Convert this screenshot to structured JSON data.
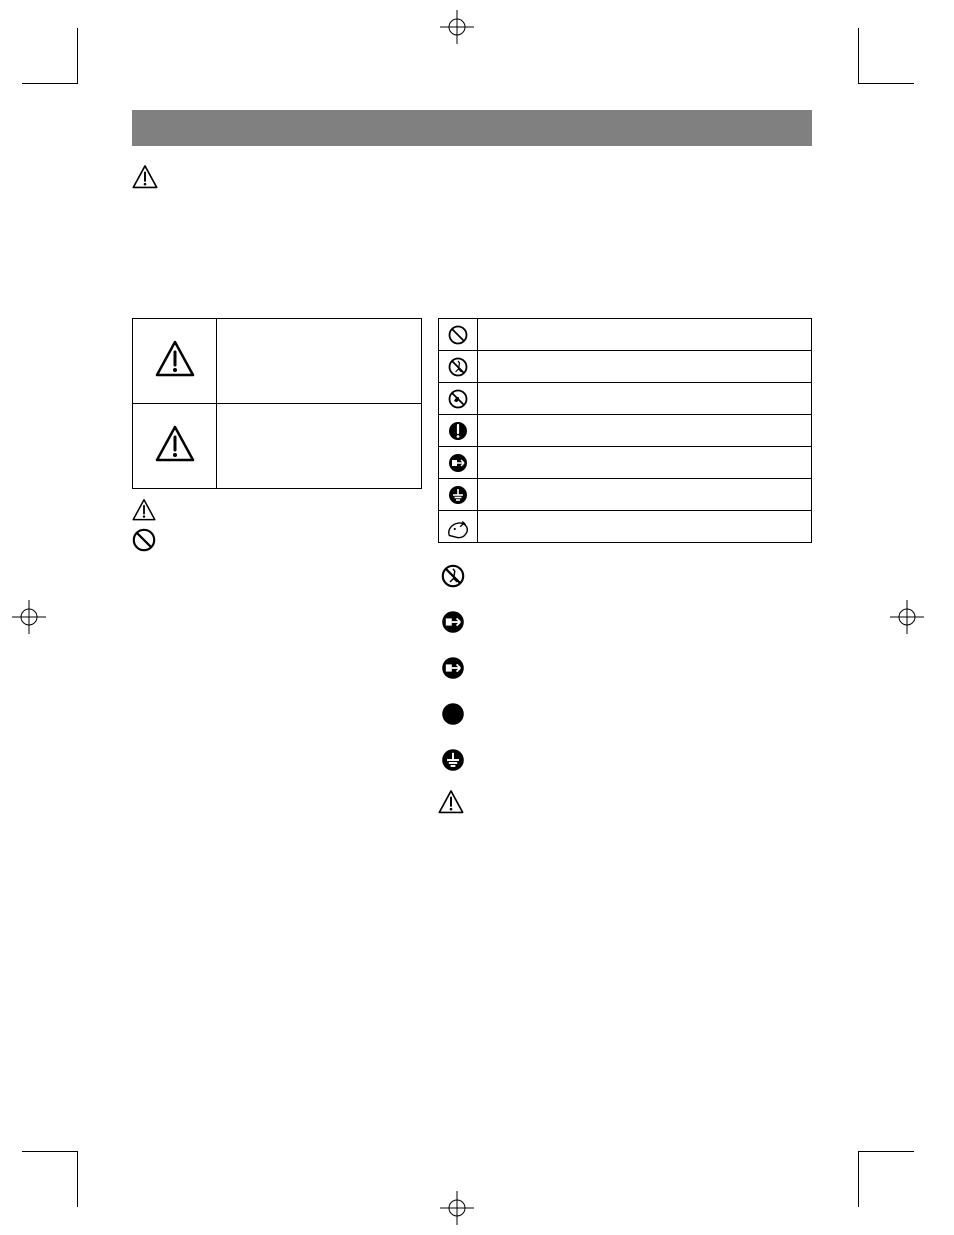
{
  "header": {
    "title": ""
  },
  "intro": {
    "text": ""
  },
  "severity_table": {
    "rows": [
      {
        "label": "",
        "desc": ""
      },
      {
        "label": "",
        "desc": ""
      }
    ]
  },
  "symbol_table": {
    "rows": [
      {
        "name": "prohibit",
        "desc": ""
      },
      {
        "name": "no-disassemble",
        "desc": ""
      },
      {
        "name": "no-wet-hands",
        "desc": ""
      },
      {
        "name": "mandatory",
        "desc": ""
      },
      {
        "name": "unplug",
        "desc": ""
      },
      {
        "name": "ground",
        "desc": ""
      },
      {
        "name": "injury",
        "desc": ""
      }
    ]
  },
  "left_notes": {
    "line1": "",
    "line2": ""
  },
  "right_notes": {
    "items": [
      {
        "name": "no-disassemble",
        "text": ""
      },
      {
        "name": "unplug",
        "text": ""
      },
      {
        "name": "unplug",
        "text": ""
      },
      {
        "name": "solid",
        "text": ""
      },
      {
        "name": "ground",
        "text": ""
      }
    ]
  },
  "warning_section": {
    "label": ""
  }
}
